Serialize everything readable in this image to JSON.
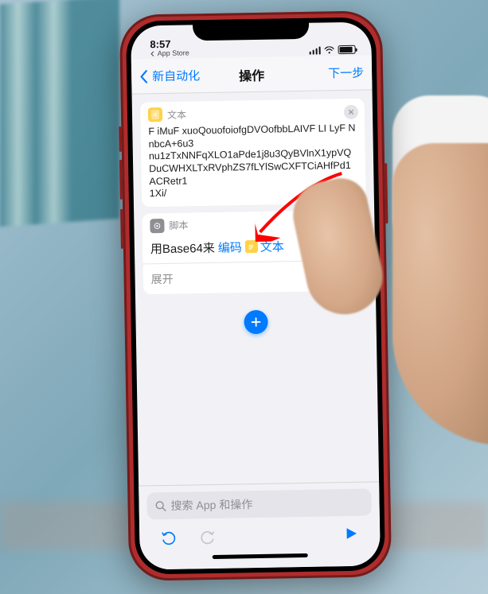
{
  "status": {
    "time": "8:57",
    "back_app": "App Store"
  },
  "nav": {
    "back_label": "新自动化",
    "title": "操作",
    "next_label": "下一步"
  },
  "text_card": {
    "header_label": "文本",
    "content_lines": [
      "F iMuF xuoQouofoiofgDVOofbbLAIVF LI LyF N",
      "nbcA+6u3",
      "nu1zTxNNFqXLO1aPde1j8u3QyBVlnX1ypVQ",
      "DuCWHXLTxRVphZS7fLYlSwCXFTCiAHfPd1",
      "ACRetr1",
      "1Xi/"
    ]
  },
  "script_card": {
    "header_label": "脚本",
    "prefix_text": "用Base64来",
    "action_token": "编码",
    "param_label": "文本",
    "expand_label": "展开"
  },
  "search": {
    "placeholder": "搜索 App 和操作"
  },
  "colors": {
    "accent": "#007aff",
    "phone": "#b02c2c",
    "arrow": "#ff0000"
  }
}
